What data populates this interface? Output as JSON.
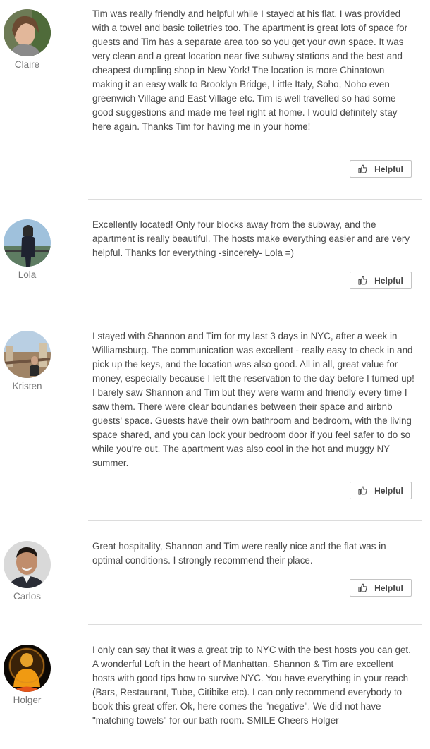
{
  "reviews": [
    {
      "name": "Claire",
      "avatar_icon": "reviewer-photo-claire",
      "text": "Tim was really friendly and helpful while I stayed at his flat. I was provided with a towel and basic toiletries too. The apartment is great lots of space for guests and Tim has a separate area too so you get your own space. It was very clean and a great location near five subway stations and the best and cheapest dumpling shop in New York! The location is more Chinatown making it an easy walk to Brooklyn Bridge, Little Italy, Soho, Noho even greenwich Village and East Village etc. Tim is well travelled so had some good suggestions and made me feel right at home. I would definitely stay here again. Thanks Tim for having me in your home!",
      "helpful_label": "Helpful"
    },
    {
      "name": "Lola",
      "avatar_icon": "reviewer-photo-lola",
      "text": "Excellently located! Only four blocks away from the subway, and the apartment is really beautiful. The hosts make everything easier and are very helpful. Thanks for everything -sincerely- Lola =)",
      "helpful_label": "Helpful"
    },
    {
      "name": "Kristen",
      "avatar_icon": "reviewer-photo-kristen",
      "text": "I stayed with Shannon and Tim for my last 3 days in NYC, after a week in Williamsburg. The communication was excellent - really easy to check in and pick up the keys, and the location was also good. All in all, great value for money, especially because I left the reservation to the day before I turned up! I barely saw Shannon and Tim but they were warm and friendly every time I saw them. There were clear boundaries between their space and airbnb guests' space. Guests have their own bathroom and bedroom, with the living space shared, and you can lock your bedroom door if you feel safer to do so while you're out. The apartment was also cool in the hot and muggy NY summer.",
      "helpful_label": "Helpful"
    },
    {
      "name": "Carlos",
      "avatar_icon": "reviewer-photo-carlos",
      "text": "Great hospitality, Shannon and Tim were really nice and the flat was in optimal conditions. I strongly recommend their place.",
      "helpful_label": "Helpful"
    },
    {
      "name": "Holger",
      "avatar_icon": "reviewer-photo-holger",
      "text": "I only can say that it was a great trip to NYC with the best hosts you can get. A wonderful Loft in the heart of Manhattan. Shannon & Tim are excellent hosts with good tips how to survive NYC. You have everything in your reach (Bars, Restaurant, Tube, Citibike etc). I can only recommend everybody to book this great offer. Ok, here comes the \"negative\". We did not have \"matching towels\" for our bath room. SMILE Cheers Holger"
    }
  ],
  "colors": {
    "text": "#484848",
    "name": "#767676",
    "divider": "#dcdcdc",
    "button_border": "#c4c4c4"
  }
}
